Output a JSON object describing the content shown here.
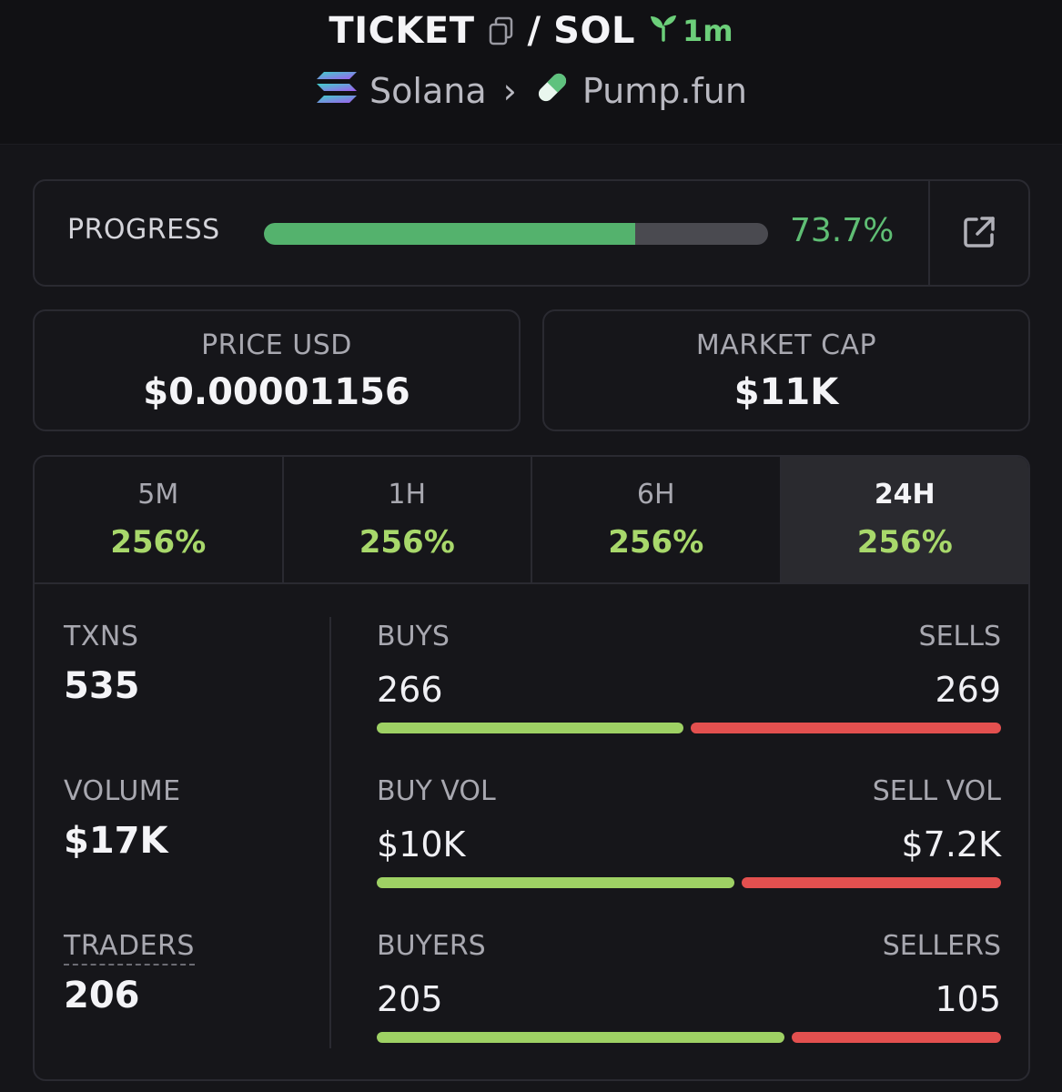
{
  "header": {
    "token": "TICKET",
    "separator": "/",
    "pair_quote": "SOL",
    "age": "1m",
    "chain": "Solana",
    "crumb_separator": "›",
    "dex": "Pump.fun",
    "icons": [
      "copy-icon",
      "seedling-icon",
      "solana-logo-icon",
      "pill-icon"
    ]
  },
  "progress": {
    "label": "PROGRESS",
    "value_text": "73.7%",
    "value": 73.7,
    "external_link_icon": "external-link-icon"
  },
  "stats": {
    "price": {
      "label": "PRICE USD",
      "value": "$0.00001156"
    },
    "market_cap": {
      "label": "MARKET CAP",
      "value": "$11K"
    }
  },
  "tabs": [
    {
      "label": "5M",
      "value": "256%"
    },
    {
      "label": "1H",
      "value": "256%"
    },
    {
      "label": "6H",
      "value": "256%"
    },
    {
      "label": "24H",
      "value": "256%",
      "active": true
    }
  ],
  "metrics": {
    "txns": {
      "label": "TXNS",
      "value": "535"
    },
    "volume": {
      "label": "VOLUME",
      "value": "$17K"
    },
    "traders": {
      "label": "TRADERS",
      "value": "206"
    }
  },
  "pairs": {
    "txns": {
      "left_label": "BUYS",
      "left_value": "266",
      "right_label": "SELLS",
      "right_value": "269",
      "buy_share": 0.497
    },
    "volume": {
      "left_label": "BUY VOL",
      "left_value": "$10K",
      "right_label": "SELL VOL",
      "right_value": "$7.2K",
      "buy_share": 0.58
    },
    "traders": {
      "left_label": "BUYERS",
      "left_value": "205",
      "right_label": "SELLERS",
      "right_value": "105",
      "buy_share": 0.661
    }
  },
  "colors": {
    "background": "#151519",
    "positive": "#a8d86b",
    "progress_green": "#54b26d",
    "buy_bar": "#9ed164",
    "sell_bar": "#e3504f",
    "age_green": "#6ccf7a"
  }
}
